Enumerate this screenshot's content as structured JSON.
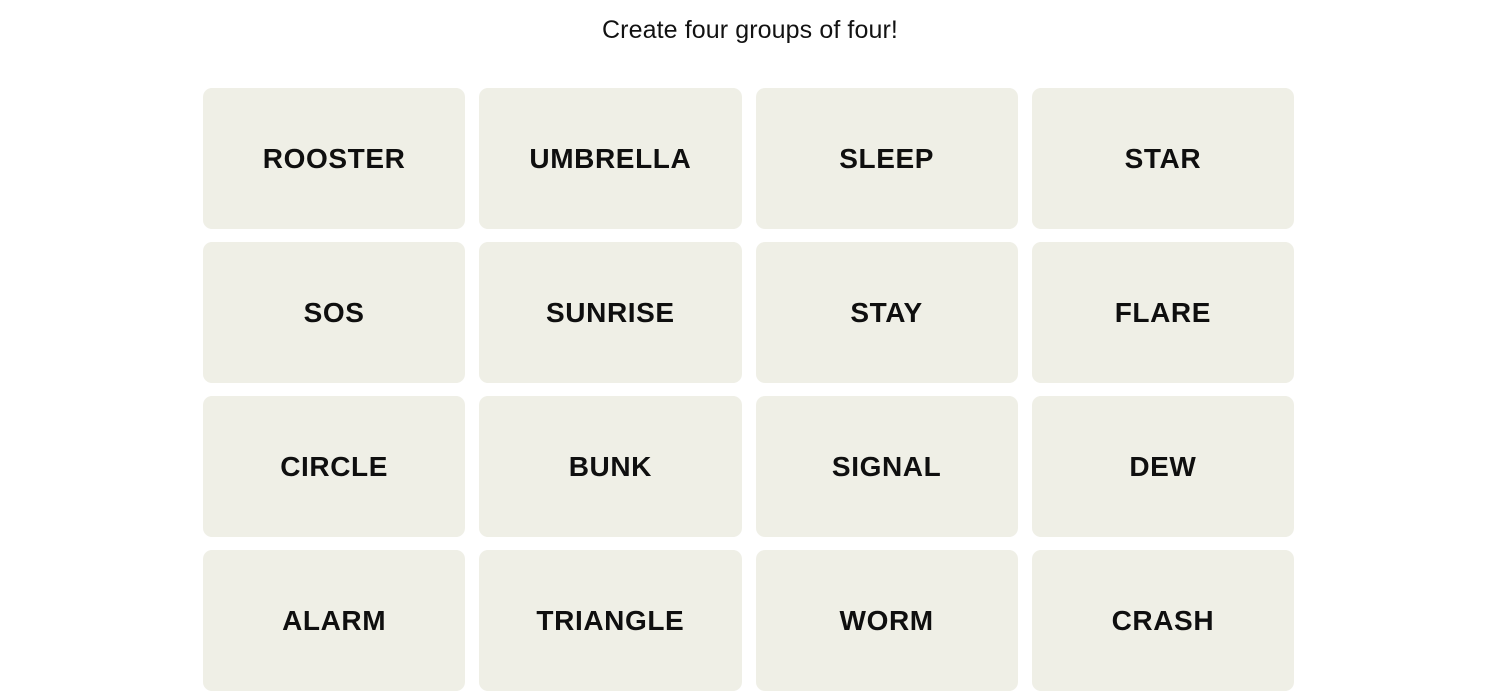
{
  "instruction": "Create four groups of four!",
  "colors": {
    "page_background": "#ffffff",
    "tile_background": "#EFEFE6",
    "tile_text": "#0f0f0f",
    "instruction_text": "#121212"
  },
  "board": {
    "rows": 4,
    "columns": 4,
    "tiles": [
      {
        "label": "ROOSTER"
      },
      {
        "label": "UMBRELLA"
      },
      {
        "label": "SLEEP"
      },
      {
        "label": "STAR"
      },
      {
        "label": "SOS"
      },
      {
        "label": "SUNRISE"
      },
      {
        "label": "STAY"
      },
      {
        "label": "FLARE"
      },
      {
        "label": "CIRCLE"
      },
      {
        "label": "BUNK"
      },
      {
        "label": "SIGNAL"
      },
      {
        "label": "DEW"
      },
      {
        "label": "ALARM"
      },
      {
        "label": "TRIANGLE"
      },
      {
        "label": "WORM"
      },
      {
        "label": "CRASH"
      }
    ]
  }
}
